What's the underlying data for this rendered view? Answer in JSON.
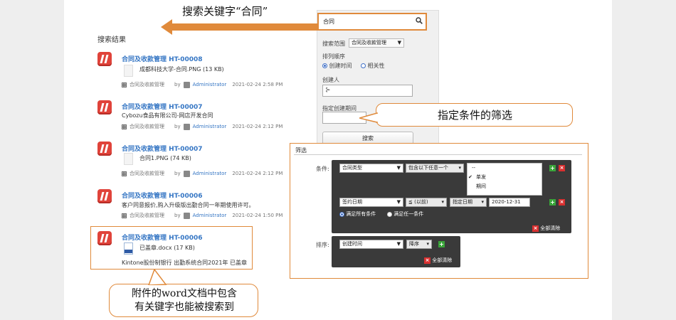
{
  "search_callout": "搜索关键字“合同”",
  "filter_callout": "指定条件的筛选",
  "attachment_callout": [
    "附件的word文档中包含",
    "有关键字也能被搜索到"
  ],
  "results": {
    "title": "搜索结果",
    "items": [
      {
        "title": "合同及收款管理 HT-00008",
        "attach": "成都科技大学-合同.PNG (13 KB)",
        "app": "合同及收款管理",
        "by": "by",
        "user": "Administrator",
        "date": "2021-02-24 2:58 PM"
      },
      {
        "title": "合同及收款管理 HT-00007",
        "text": "Cybozu食品有限公司-网店开发合同",
        "app": "合同及收款管理",
        "by": "by",
        "user": "Administrator",
        "date": "2021-02-24 2:12 PM"
      },
      {
        "title": "合同及收款管理 HT-00007",
        "attach": "合同1.PNG (74 KB)",
        "app": "合同及收款管理",
        "by": "by",
        "user": "Administrator",
        "date": "2021-02-24 2:12 PM"
      },
      {
        "title": "合同及收款管理 HT-00006",
        "text": "客户同意报价,购入升级版出勤合同一年期使用许可。",
        "app": "合同及收款管理",
        "by": "by",
        "user": "Administrator",
        "date": "2021-02-24 1:50 PM"
      },
      {
        "title": "合同及收款管理 HT-00006",
        "attach": "已盖章.docx (17 KB)",
        "text": "Kintone股份制银行 出勤系统合同2021年 已盖章"
      }
    ]
  },
  "sidebar": {
    "search_value": "合同",
    "scope_label": "搜索范围",
    "scope_value": "合同及收款管理",
    "sort_label": "排列顺序",
    "sort_options": [
      "创建时间",
      "相关性"
    ],
    "creator_label": "创建人",
    "date_label": "指定创建期间",
    "date_sep": "~",
    "search_button": "搜索"
  },
  "filter": {
    "title": "筛选",
    "condition_label": "条件:",
    "sort_label": "排序:",
    "field1": "合同类型",
    "op1": "包含以下任意一个",
    "options": [
      "--",
      "单发",
      "期间"
    ],
    "checked_option": "单发",
    "field2": "签约日期",
    "op2": "≦ (以前)",
    "op2b": "指定日期",
    "date_value": "2020-12-31",
    "match_all": "满足所有条件",
    "match_any": "满足任一条件",
    "clear_all": "全部清除",
    "sort_field": "创建时间",
    "sort_dir": "降序"
  },
  "colors": {
    "accent": "#e08a3b",
    "link": "#3576c4",
    "dark_panel": "#3a3a3a"
  }
}
